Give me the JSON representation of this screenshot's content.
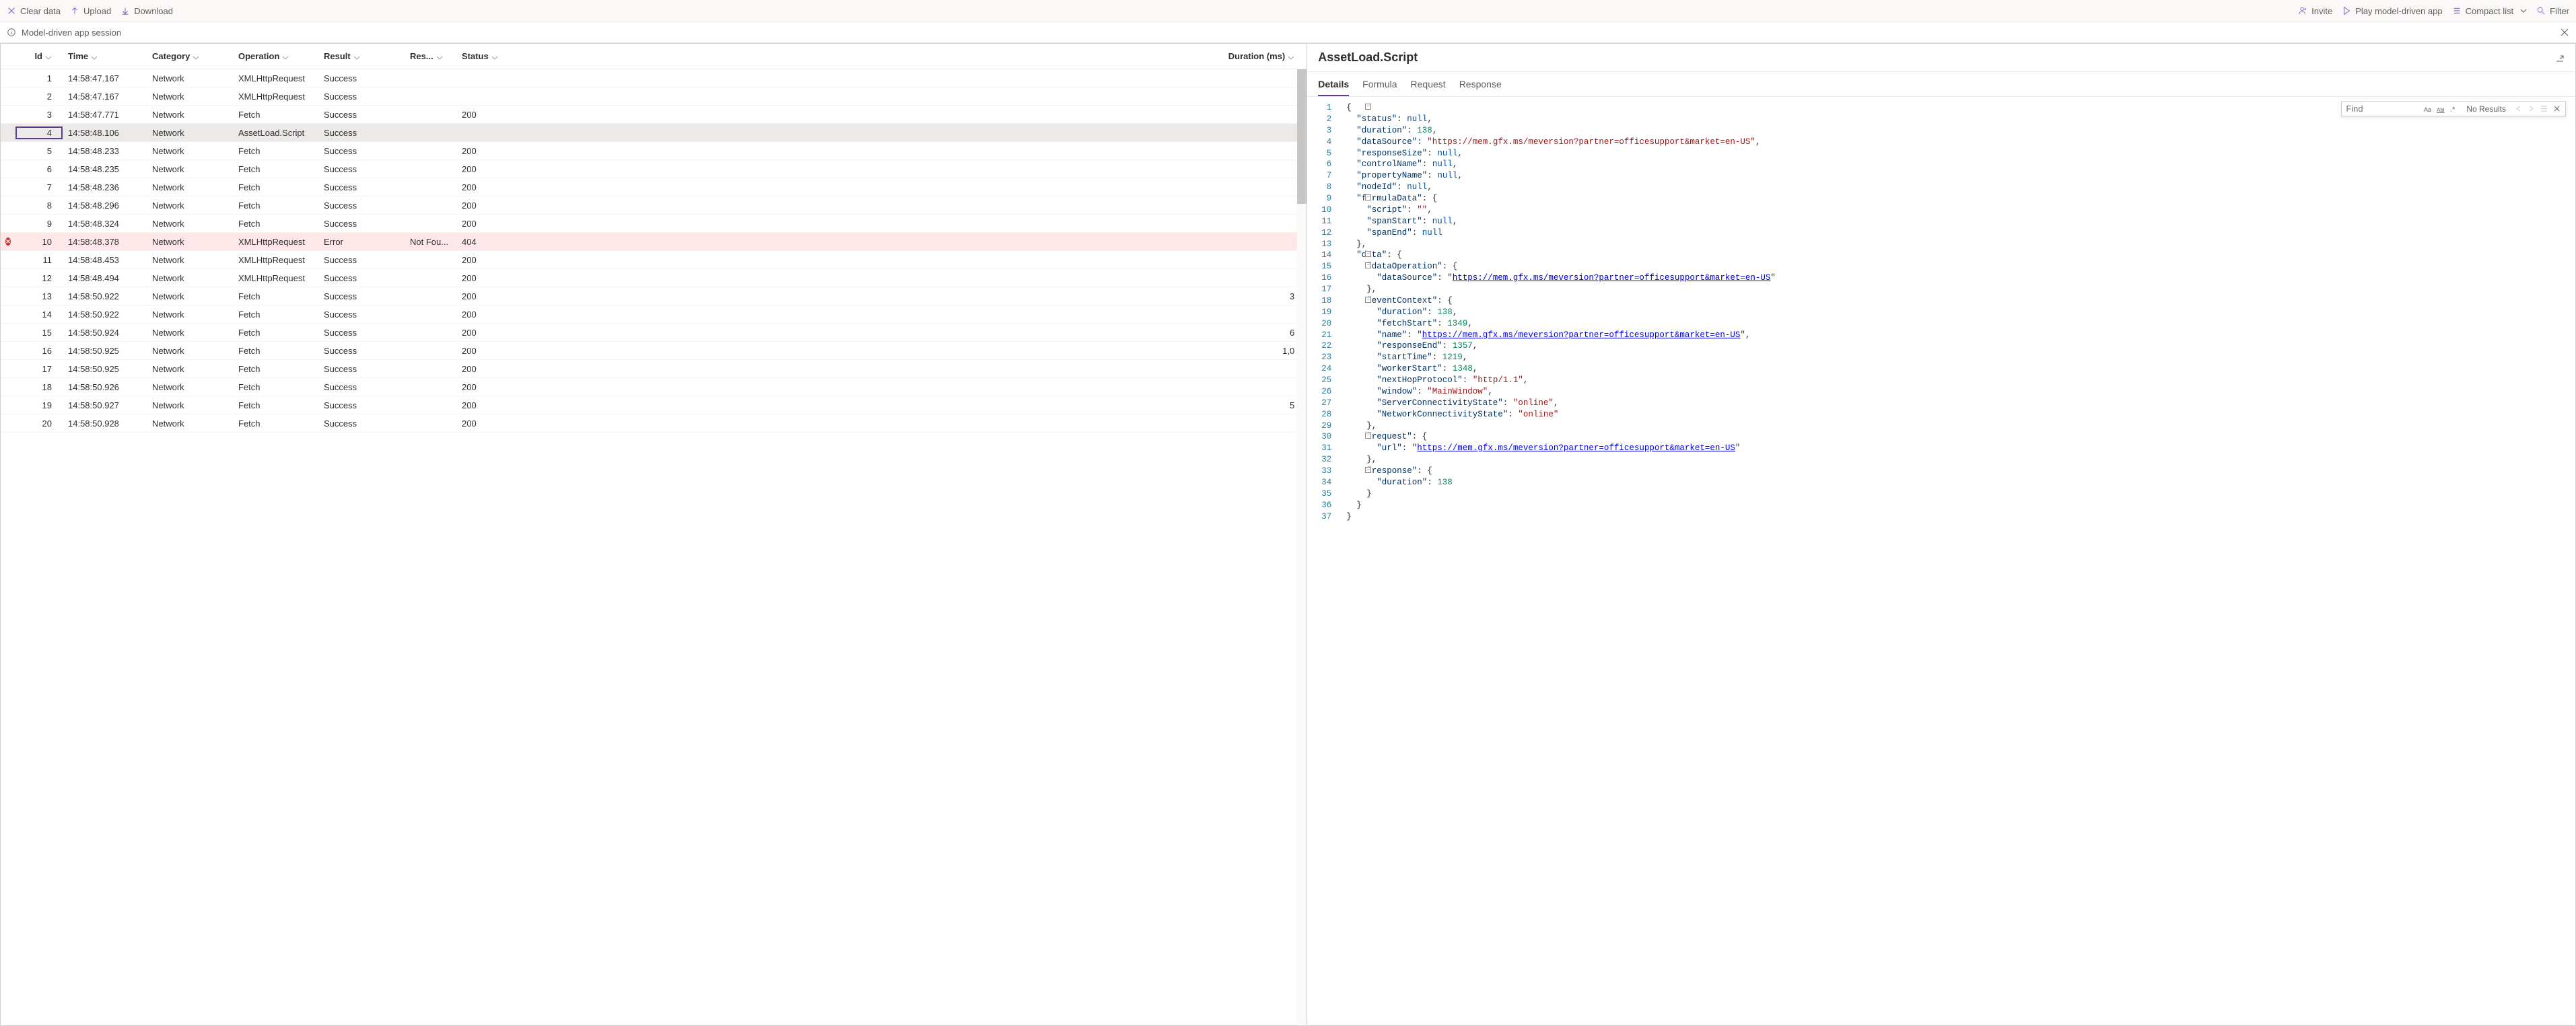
{
  "toolbar": {
    "clear": "Clear data",
    "upload": "Upload",
    "download": "Download",
    "invite": "Invite",
    "play": "Play model-driven app",
    "compact": "Compact list",
    "filter": "Filter"
  },
  "session": {
    "title": "Model-driven app session"
  },
  "columns": {
    "id": "Id",
    "time": "Time",
    "category": "Category",
    "operation": "Operation",
    "result": "Result",
    "res2": "Res...",
    "status": "Status",
    "duration": "Duration (ms)"
  },
  "rows": [
    {
      "id": "1",
      "time": "14:58:47.167",
      "cat": "Network",
      "op": "XMLHttpRequest",
      "res": "Success",
      "res2": "",
      "status": "",
      "dur": ""
    },
    {
      "id": "2",
      "time": "14:58:47.167",
      "cat": "Network",
      "op": "XMLHttpRequest",
      "res": "Success",
      "res2": "",
      "status": "",
      "dur": ""
    },
    {
      "id": "3",
      "time": "14:58:47.771",
      "cat": "Network",
      "op": "Fetch",
      "res": "Success",
      "res2": "",
      "status": "200",
      "dur": ""
    },
    {
      "id": "4",
      "time": "14:58:48.106",
      "cat": "Network",
      "op": "AssetLoad.Script",
      "res": "Success",
      "res2": "",
      "status": "",
      "dur": "",
      "sel": true
    },
    {
      "id": "5",
      "time": "14:58:48.233",
      "cat": "Network",
      "op": "Fetch",
      "res": "Success",
      "res2": "",
      "status": "200",
      "dur": ""
    },
    {
      "id": "6",
      "time": "14:58:48.235",
      "cat": "Network",
      "op": "Fetch",
      "res": "Success",
      "res2": "",
      "status": "200",
      "dur": ""
    },
    {
      "id": "7",
      "time": "14:58:48.236",
      "cat": "Network",
      "op": "Fetch",
      "res": "Success",
      "res2": "",
      "status": "200",
      "dur": ""
    },
    {
      "id": "8",
      "time": "14:58:48.296",
      "cat": "Network",
      "op": "Fetch",
      "res": "Success",
      "res2": "",
      "status": "200",
      "dur": ""
    },
    {
      "id": "9",
      "time": "14:58:48.324",
      "cat": "Network",
      "op": "Fetch",
      "res": "Success",
      "res2": "",
      "status": "200",
      "dur": ""
    },
    {
      "id": "10",
      "time": "14:58:48.378",
      "cat": "Network",
      "op": "XMLHttpRequest",
      "res": "Error",
      "res2": "Not Fou...",
      "status": "404",
      "dur": "",
      "err": true
    },
    {
      "id": "11",
      "time": "14:58:48.453",
      "cat": "Network",
      "op": "XMLHttpRequest",
      "res": "Success",
      "res2": "",
      "status": "200",
      "dur": ""
    },
    {
      "id": "12",
      "time": "14:58:48.494",
      "cat": "Network",
      "op": "XMLHttpRequest",
      "res": "Success",
      "res2": "",
      "status": "200",
      "dur": ""
    },
    {
      "id": "13",
      "time": "14:58:50.922",
      "cat": "Network",
      "op": "Fetch",
      "res": "Success",
      "res2": "",
      "status": "200",
      "dur": "3"
    },
    {
      "id": "14",
      "time": "14:58:50.922",
      "cat": "Network",
      "op": "Fetch",
      "res": "Success",
      "res2": "",
      "status": "200",
      "dur": ""
    },
    {
      "id": "15",
      "time": "14:58:50.924",
      "cat": "Network",
      "op": "Fetch",
      "res": "Success",
      "res2": "",
      "status": "200",
      "dur": "6"
    },
    {
      "id": "16",
      "time": "14:58:50.925",
      "cat": "Network",
      "op": "Fetch",
      "res": "Success",
      "res2": "",
      "status": "200",
      "dur": "1,0"
    },
    {
      "id": "17",
      "time": "14:58:50.925",
      "cat": "Network",
      "op": "Fetch",
      "res": "Success",
      "res2": "",
      "status": "200",
      "dur": ""
    },
    {
      "id": "18",
      "time": "14:58:50.926",
      "cat": "Network",
      "op": "Fetch",
      "res": "Success",
      "res2": "",
      "status": "200",
      "dur": ""
    },
    {
      "id": "19",
      "time": "14:58:50.927",
      "cat": "Network",
      "op": "Fetch",
      "res": "Success",
      "res2": "",
      "status": "200",
      "dur": "5"
    },
    {
      "id": "20",
      "time": "14:58:50.928",
      "cat": "Network",
      "op": "Fetch",
      "res": "Success",
      "res2": "",
      "status": "200",
      "dur": ""
    }
  ],
  "detail": {
    "title": "AssetLoad.Script",
    "tabs": {
      "details": "Details",
      "formula": "Formula",
      "request": "Request",
      "response": "Response"
    },
    "find": {
      "placeholder": "Find",
      "noresults": "No Results"
    },
    "json": {
      "status": null,
      "duration": 138,
      "dataSource": "https://mem.gfx.ms/meversion?partner=officesupport&market=en-US",
      "responseSize": null,
      "controlName": null,
      "propertyName": null,
      "nodeId": null,
      "formulaData": {
        "script": "",
        "spanStart": null,
        "spanEnd": null
      },
      "data": {
        "dataOperation": {
          "dataSource": "https://mem.gfx.ms/meversion?partner=officesupport&market=en-US"
        },
        "eventContext": {
          "duration": 138,
          "fetchStart": 1349,
          "name": "https://mem.gfx.ms/meversion?partner=officesupport&market=en-US",
          "responseEnd": 1357,
          "startTime": 1219,
          "workerStart": 1348,
          "nextHopProtocol": "http/1.1",
          "window": "MainWindow",
          "ServerConnectivityState": "online",
          "NetworkConnectivityState": "online"
        },
        "request": {
          "url": "https://mem.gfx.ms/meversion?partner=officesupport&market=en-US"
        },
        "response": {
          "duration": 138
        }
      }
    }
  }
}
